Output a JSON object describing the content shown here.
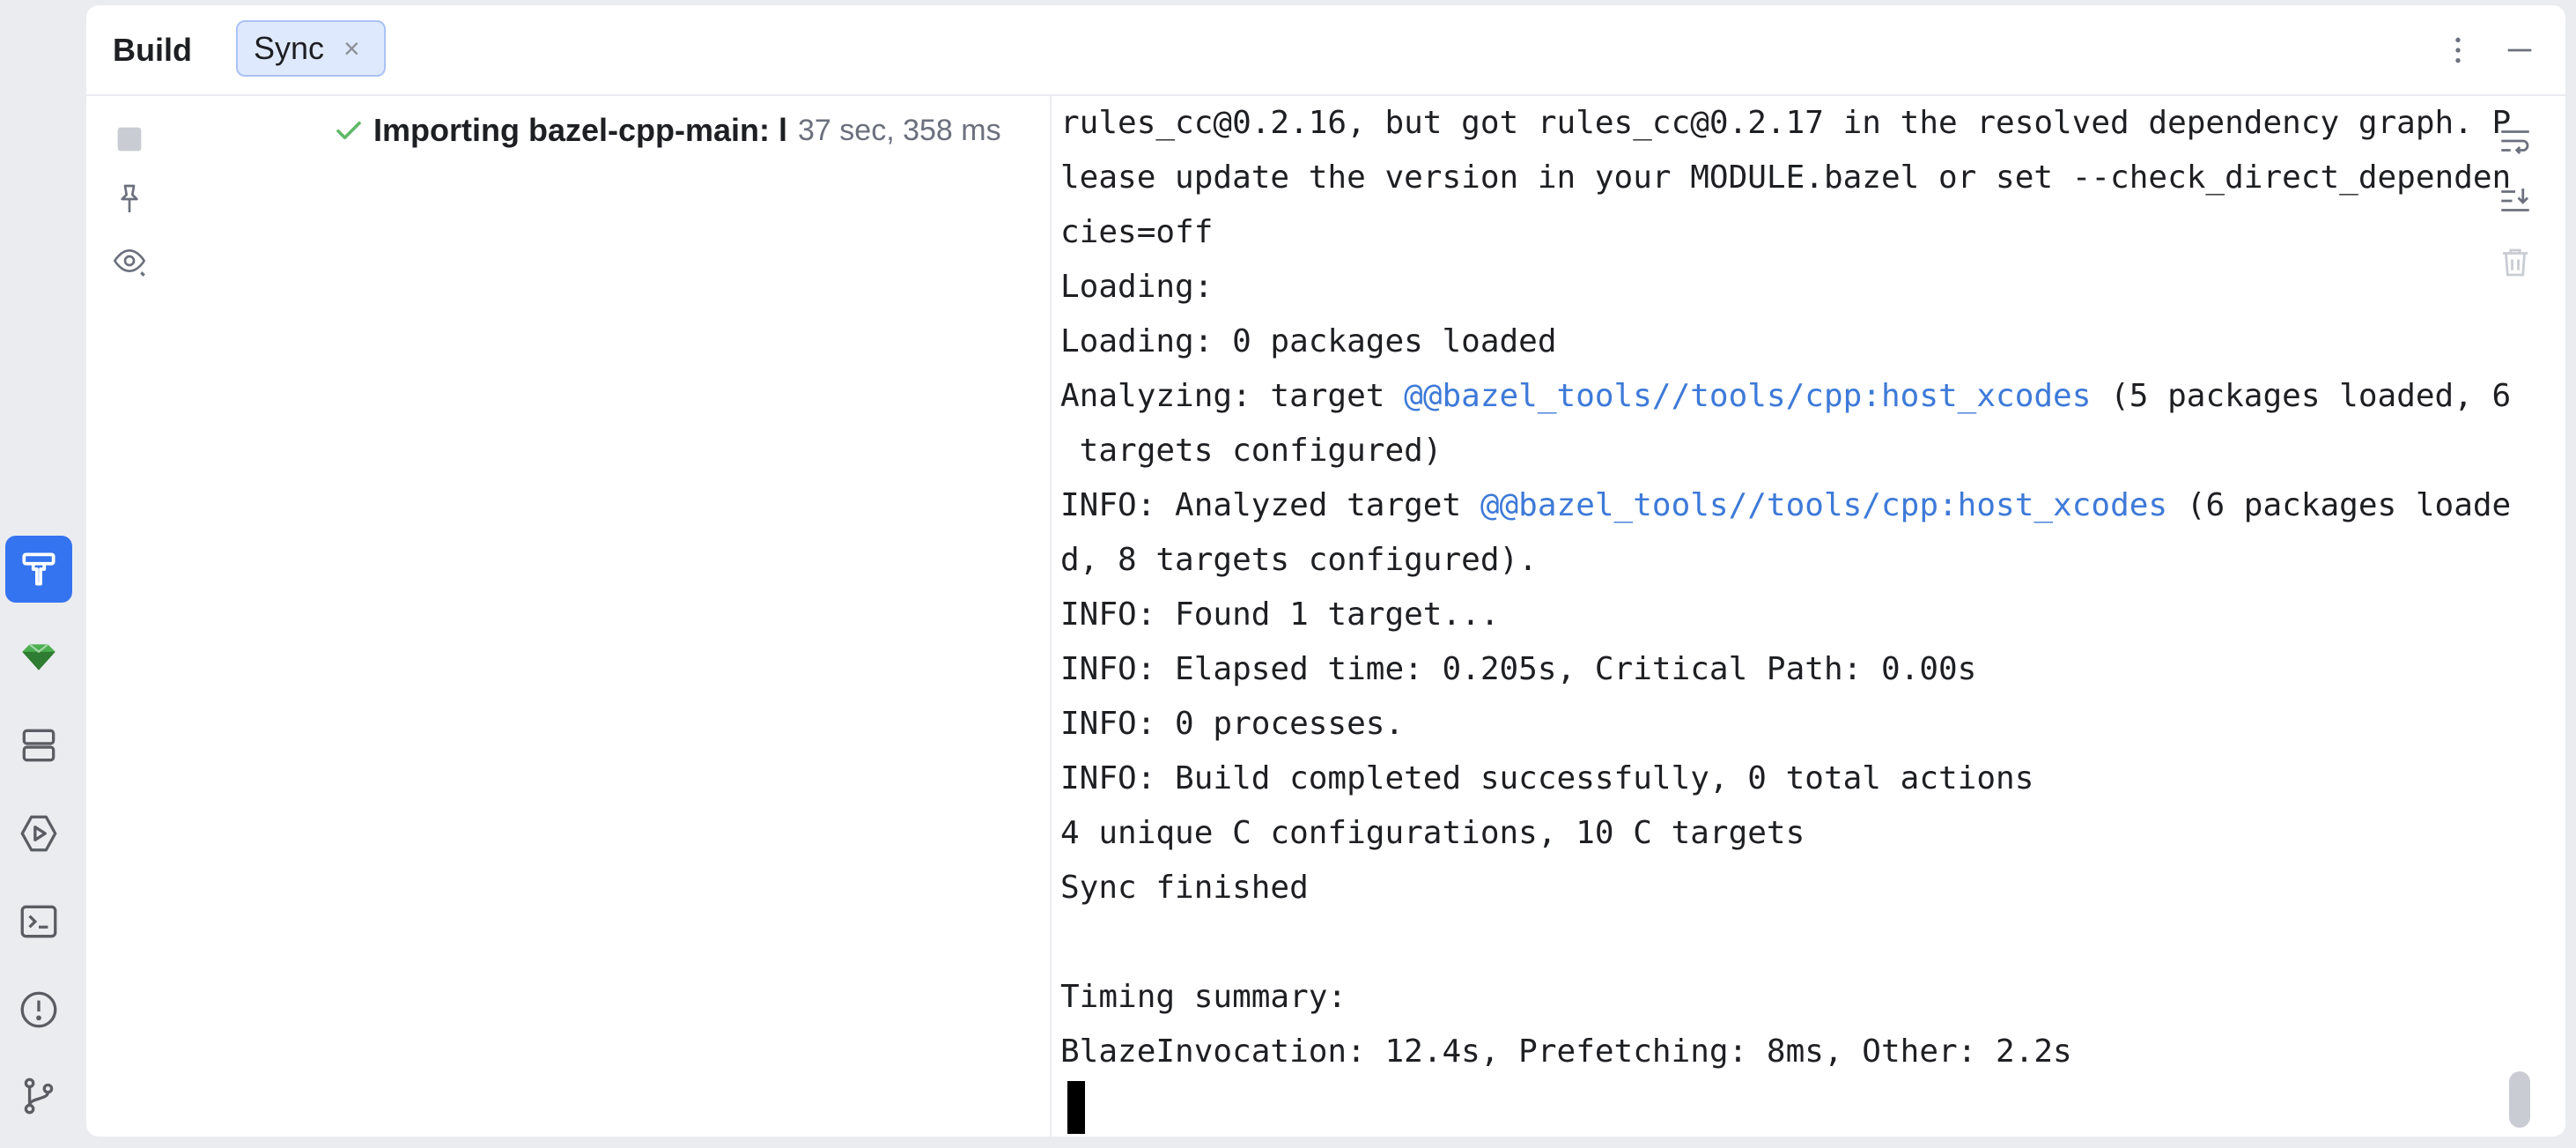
{
  "toolwindow": {
    "title": "Build",
    "tabs": [
      {
        "label": "Sync",
        "close_glyph": "×"
      }
    ]
  },
  "tree": {
    "root": {
      "status_icon": "check-icon",
      "label": "Importing bazel-cpp-main: l",
      "duration": "37 sec, 358 ms"
    }
  },
  "console": {
    "lines": [
      {
        "text": "rules_cc@0.2.16, but got rules_cc@0.2.17 in the resolved dependency graph. P"
      },
      {
        "text": "lease update the version in your MODULE.bazel or set --check_direct_dependen"
      },
      {
        "text": "cies=off"
      },
      {
        "text": "Loading:"
      },
      {
        "text": "Loading: 0 packages loaded"
      },
      {
        "pre": "Analyzing: target ",
        "link": "@@bazel_tools//tools/cpp:host_xcodes",
        "post": " (5 packages loaded, 6"
      },
      {
        "text": " targets configured)"
      },
      {
        "pre": "INFO: Analyzed target ",
        "link": "@@bazel_tools//tools/cpp:host_xcodes",
        "post": " (6 packages loade"
      },
      {
        "text": "d, 8 targets configured)."
      },
      {
        "text": "INFO: Found 1 target..."
      },
      {
        "text": "INFO: Elapsed time: 0.205s, Critical Path: 0.00s"
      },
      {
        "text": "INFO: 0 processes."
      },
      {
        "text": "INFO: Build completed successfully, 0 total actions"
      },
      {
        "text": "4 unique C configurations, 10 C targets"
      },
      {
        "text": "Sync finished"
      },
      {
        "text": ""
      },
      {
        "text": "Timing summary:"
      },
      {
        "text": "BlazeInvocation: 12.4s, Prefetching: 8ms, Other: 2.2s"
      }
    ]
  },
  "icons": {
    "strip": [
      "build-hammer-icon",
      "gem-plugin-icon",
      "structure-icon",
      "run-services-icon",
      "terminal-icon",
      "problems-icon",
      "git-branch-icon"
    ],
    "header": [
      "more-options-icon",
      "minimize-icon"
    ],
    "gutter": [
      "stop-icon",
      "pin-icon",
      "eye-icon"
    ],
    "console_toolbar": [
      "soft-wrap-icon",
      "scroll-to-end-icon",
      "clear-trash-icon"
    ]
  },
  "colors": {
    "accent": "#3574f0",
    "link": "#3e7ad8",
    "success": "#5fb865",
    "tab_bg": "#dfe9fd"
  }
}
